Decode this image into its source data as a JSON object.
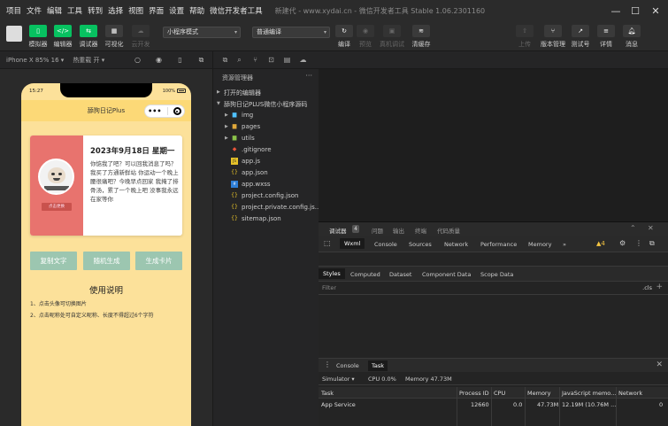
{
  "menubar": {
    "items": [
      "项目",
      "文件",
      "编辑",
      "工具",
      "转到",
      "选择",
      "视图",
      "界面",
      "设置",
      "帮助",
      "微信开发者工具"
    ],
    "title": "新建代 - www.xydai.cn  -  微信开发者工具 Stable 1.06.2301160"
  },
  "toolbar": {
    "simulator": "模拟器",
    "editor": "编辑器",
    "debugger": "调试器",
    "visual": "可视化",
    "cloud": "云开发",
    "mode_select": "小程序模式",
    "compile_select": "普通编译",
    "compile": "编译",
    "preview": "预览",
    "remote_debug": "真机调试",
    "clear_cache": "清缓存",
    "upload": "上传",
    "version": "版本管理",
    "test": "测试号",
    "details": "详情",
    "messages": "消息"
  },
  "simbar": {
    "device": "iPhone X 85% 16 ▾",
    "hotreload": "热重载 开 ▾"
  },
  "phone": {
    "time": "15:27",
    "battery": "100%",
    "nav_title": "舔狗日记Plus",
    "capsule_dots": "•••",
    "card_tag": "点击更换",
    "card_date": "2023年9月18日 星期一",
    "card_text": "你惦我了吧？可以回我消息了吗？我买了方通新鲜站 你运动一个晚上腰很痛吧？今晚早点回家 我掩了排骨汤，累了一个晚上吧 没事我永远在家等你",
    "buttons": [
      "复制文字",
      "随机生成",
      "生成卡片"
    ],
    "usage_title": "使用说明",
    "usage_items": [
      "1、点击头像可切换图片",
      "2、点击昵称处可自定义昵称、长度不得超过6个字符"
    ]
  },
  "explorer": {
    "header": "资源管理器",
    "more": "···",
    "open_editors": "打开的编辑器",
    "project": "舔狗日记PLUS微信小程序源码",
    "items": [
      {
        "name": "img",
        "icon": "folder-icon"
      },
      {
        "name": "pages",
        "icon": "folder-icon"
      },
      {
        "name": "utils",
        "icon": "folder-icon"
      },
      {
        "name": ".gitignore",
        "icon": "git-icon"
      },
      {
        "name": "app.js",
        "icon": "js-icon"
      },
      {
        "name": "app.json",
        "icon": "json-icon"
      },
      {
        "name": "app.wxss",
        "icon": "wxss-icon"
      },
      {
        "name": "project.config.json",
        "icon": "json-icon"
      },
      {
        "name": "project.private.config.js...",
        "icon": "json-icon"
      },
      {
        "name": "sitemap.json",
        "icon": "json-icon"
      }
    ]
  },
  "devtools": {
    "top_tabs": [
      "调试器",
      "问题",
      "输出",
      "终端",
      "代码质量"
    ],
    "debugger_badge": "4",
    "panel_tabs": [
      "Wxml",
      "Console",
      "Sources",
      "Network",
      "Performance",
      "Memory",
      "»"
    ],
    "warnings": "▲4",
    "style_tabs": [
      "Styles",
      "Computed",
      "Dataset",
      "Component Data",
      "Scope Data"
    ],
    "filter_placeholder": "Filter",
    "cls": ".cls",
    "plus": "+",
    "console_tabs": [
      "Console",
      "Task"
    ],
    "taskbar": {
      "target": "Simulator ▾",
      "cpu": "CPU 0.0%",
      "memory": "Memory 47.73M"
    },
    "table": {
      "headers": [
        "Task",
        "Process ID",
        "CPU",
        "Memory",
        "JavaScript memo...",
        "Network"
      ],
      "rows": [
        [
          "App Service",
          "12660",
          "0.0",
          "47.73M",
          "12.19M (10.76M ...",
          "0"
        ]
      ]
    }
  },
  "colors": {
    "accent_green": "#07c160",
    "phone_bg": "#fce19a",
    "card_left": "#e8736e",
    "button": "#9cc6b0"
  }
}
